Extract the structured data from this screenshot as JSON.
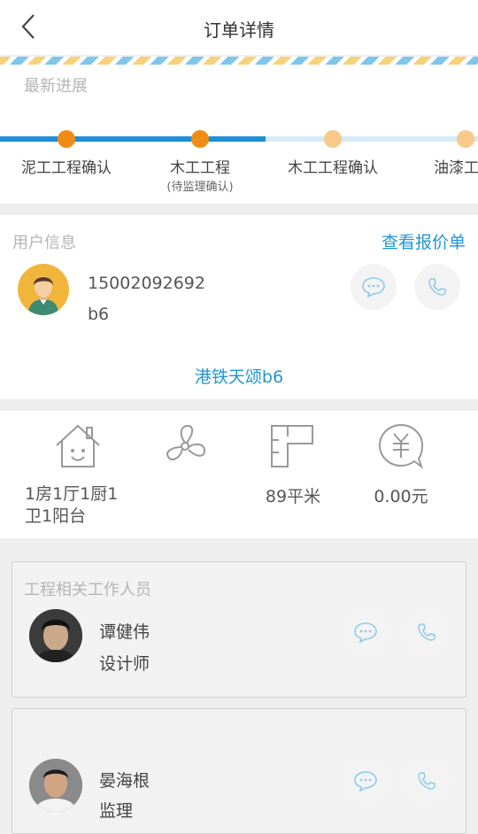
{
  "header": {
    "title": "订单详情",
    "back_icon": "chevron-left-icon"
  },
  "progress": {
    "label": "最新进展",
    "steps": [
      {
        "label": "泥工工程确认",
        "sub": "",
        "status": "done"
      },
      {
        "label": "木工工程",
        "sub": "(待监理确认)",
        "status": "current"
      },
      {
        "label": "木工工程确认",
        "sub": "",
        "status": "pending"
      },
      {
        "label": "油漆工",
        "sub": "",
        "status": "pending"
      }
    ],
    "colors": {
      "active_line": "#1e90d6",
      "pending_line": "#d3ecf7",
      "done_dot": "#f08c16",
      "pending_dot": "#f8c98a"
    }
  },
  "user": {
    "label": "用户信息",
    "quote_link": "查看报价单",
    "phone": "15002092692",
    "name": "b6",
    "community": "港铁天颂b6",
    "message_icon": "message-icon",
    "call_icon": "phone-icon"
  },
  "house": {
    "layout": "1房1厅1厨1卫1阳台",
    "layout_lines": [
      "1房1厅1厨1",
      "卫1阳台"
    ],
    "style": "",
    "area": "89平米",
    "price": "0.00元",
    "icons": [
      "house-icon",
      "fan-icon",
      "floorplan-icon",
      "yuan-icon"
    ]
  },
  "staff": {
    "label": "工程相关工作人员",
    "people": [
      {
        "name": "谭健伟",
        "role": "设计师"
      },
      {
        "name": "晏海根",
        "role": "监理"
      }
    ]
  },
  "accent_color": "#2196d3"
}
